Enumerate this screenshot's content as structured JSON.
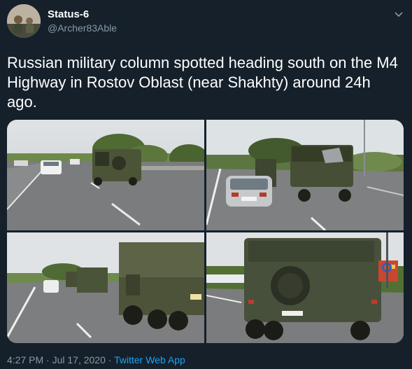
{
  "user": {
    "display_name": "Status-6",
    "handle": "@Archer83Able"
  },
  "tweet": {
    "text": "Russian military column spotted heading south on the M4\nHighway in Rostov Oblast (near Shakhty) around 24h\nago."
  },
  "media": {
    "photos": [
      {
        "alt": "truck-left-lane"
      },
      {
        "alt": "truck-behind-sedan"
      },
      {
        "alt": "convoy-trucks"
      },
      {
        "alt": "truck-rear-closeup"
      }
    ]
  },
  "footer": {
    "time": "4:27 PM",
    "separator": "·",
    "date": "Jul 17, 2020",
    "source": "Twitter Web App"
  },
  "colors": {
    "background": "#15202b",
    "secondary_text": "#8899a6",
    "link": "#1da1f2"
  },
  "icons": {
    "menu": "chevron-down-icon"
  }
}
